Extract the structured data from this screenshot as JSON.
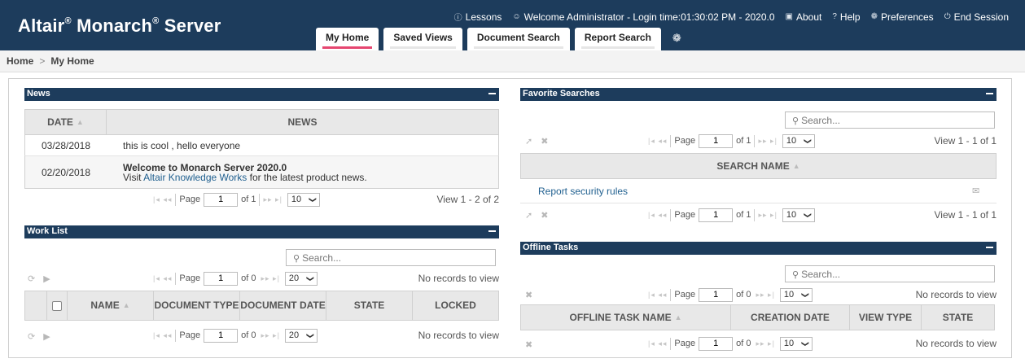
{
  "app": {
    "logo_part1": "Altair",
    "logo_part2": "Monarch",
    "logo_part3": "Server",
    "reg": "®"
  },
  "topmenu": {
    "lessons": "Lessons",
    "welcome": "Welcome Administrator - Login time:01:30:02 PM - 2020.0",
    "about": "About",
    "help": "Help",
    "preferences": "Preferences",
    "end_session": "End Session"
  },
  "tabs": [
    "My Home",
    "Saved Views",
    "Document Search",
    "Report Search"
  ],
  "breadcrumb": {
    "home": "Home",
    "current": "My Home",
    "sep": ">"
  },
  "pager_common": {
    "page_label": "Page",
    "page_value": "1",
    "first": "|◂",
    "prev": "◂◂",
    "next": "▸▸",
    "last": "▸|"
  },
  "news": {
    "title": "News",
    "col_date": "DATE",
    "col_news": "NEWS",
    "rows": [
      {
        "date": "03/28/2018",
        "text": "this is cool , hello everyone"
      },
      {
        "date": "02/20/2018",
        "bold": "Welcome to Monarch Server 2020.0",
        "pre": "Visit ",
        "link": "Altair Knowledge Works",
        "post": " for the latest product news."
      }
    ],
    "of": "of 1",
    "per_page": "10",
    "view": "View 1 - 2 of 2"
  },
  "worklist": {
    "title": "Work List",
    "search_placeholder": "Search...",
    "of": "of 0",
    "per_page": "20",
    "status": "No records to view",
    "cols": [
      "NAME",
      "DOCUMENT TYPE",
      "DOCUMENT DATE",
      "STATE",
      "LOCKED"
    ]
  },
  "favorites": {
    "title": "Favorite Searches",
    "search_placeholder": "Search...",
    "of": "of 1",
    "per_page": "10",
    "view": "View 1 - 1 of 1",
    "col": "SEARCH NAME",
    "rows": [
      "Report security rules"
    ]
  },
  "offline": {
    "title": "Offline Tasks",
    "search_placeholder": "Search...",
    "of": "of 0",
    "per_page": "10",
    "status": "No records to view",
    "cols": [
      "OFFLINE TASK NAME",
      "CREATION DATE",
      "VIEW TYPE",
      "STATE"
    ]
  },
  "colors": {
    "header": "#1d3c5c",
    "tab_accent": "#e64670",
    "link": "#1f5f8f"
  }
}
